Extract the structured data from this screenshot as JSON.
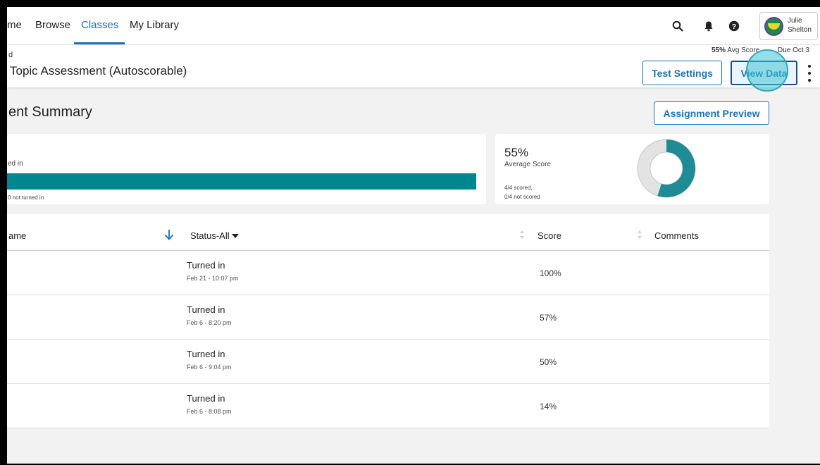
{
  "nav": {
    "items": [
      {
        "label": "me",
        "active": false
      },
      {
        "label": "Browse",
        "active": false
      },
      {
        "label": "Classes",
        "active": true
      },
      {
        "label": "My Library",
        "active": false
      }
    ],
    "icons": [
      "search-icon",
      "bell-icon",
      "help-icon"
    ],
    "user": {
      "first": "Julie",
      "last": "Shelton"
    }
  },
  "header": {
    "breadcrumb": "d",
    "title": "Topic Assessment (Autoscorable)",
    "avg_score_value": "55%",
    "avg_score_label": "Avg Score",
    "due": "Due Oct 3",
    "test_settings_label": "Test Settings",
    "view_data_label": "View Data"
  },
  "summary": {
    "title": "ent Summary",
    "preview_label": "Assignment Preview",
    "turned_in": {
      "label": "ed in",
      "fraction": 1.0,
      "not_turned_in": "0 not turned in"
    },
    "score": {
      "percent": "55%",
      "label": "Average Score",
      "scored": "4/4 scored,",
      "not_scored": "0/4 not scored",
      "fraction": 0.55
    }
  },
  "table": {
    "headers": {
      "name": "ame",
      "status": "Status-All",
      "score": "Score",
      "comments": "Comments"
    },
    "rows": [
      {
        "status": "Turned in",
        "date": "Feb 21 - 10:07 pm",
        "score": "100%"
      },
      {
        "status": "Turned in",
        "date": "Feb 6 - 8:20 pm",
        "score": "57%"
      },
      {
        "status": "Turned in",
        "date": "Feb 6 - 9:04 pm",
        "score": "50%"
      },
      {
        "status": "Turned in",
        "date": "Feb 6 - 8:08 pm",
        "score": "14%"
      }
    ]
  },
  "colors": {
    "accent": "#1b72b8",
    "teal": "#00868f",
    "donut_fill": "#1f8b94",
    "donut_track": "#e3e3e3"
  }
}
